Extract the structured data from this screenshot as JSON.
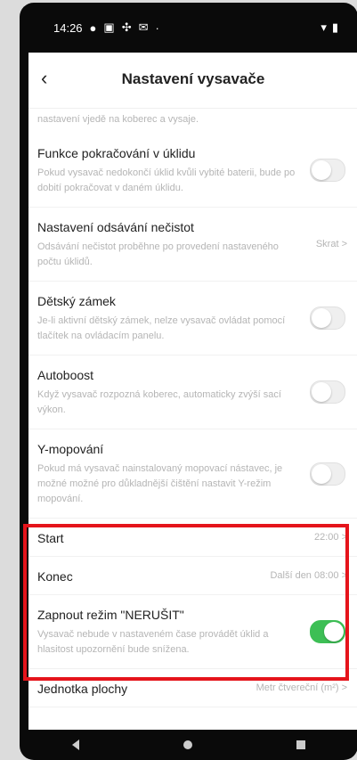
{
  "status_bar": {
    "time": "14:26",
    "icons_left": [
      "notification-dot",
      "notification-icon",
      "settings-icon",
      "mail-icon",
      "dot"
    ],
    "icons_right": [
      "wifi-icon",
      "battery-icon"
    ]
  },
  "header": {
    "title": "Nastavení vysavače"
  },
  "faded_top": "nastavení vjedě na koberec a vysaje.",
  "rows": [
    {
      "title": "Funkce pokračování v úklidu",
      "desc": "Pokud vysavač nedokončí úklid kvůli vybité baterii, bude po dobití pokračovat v daném úklidu.",
      "control": "toggle",
      "on": false
    },
    {
      "title": "Nastavení odsávání nečistot",
      "desc": "Odsávání nečistot proběhne po provedení nastaveného počtu úklidů.",
      "control": "value",
      "value": "Skrat >"
    },
    {
      "title": "Dětský zámek",
      "desc": "Je-li aktivní dětský zámek, nelze vysavač ovládat pomocí tlačítek na ovládacím panelu.",
      "control": "toggle",
      "on": false
    },
    {
      "title": "Autoboost",
      "desc": "Když vysavač rozpozná koberec, automaticky zvýší sací výkon.",
      "control": "toggle",
      "on": false
    },
    {
      "title": "Y-mopování",
      "desc": "Pokud má vysavač nainstalovaný mopovací nástavec, je možné možné pro důkladnější čištění nastavit Y-režim mopování.",
      "control": "toggle",
      "on": false
    },
    {
      "title": "Start",
      "desc": "",
      "control": "value",
      "value": "22:00 >"
    },
    {
      "title": "Konec",
      "desc": "",
      "control": "value",
      "value": "Další den 08:00 >"
    },
    {
      "title": "Zapnout režim \"NERUŠIT\"",
      "desc": "Vysavač nebude v nastaveném čase provádět úklid a hlasitost upozornění bude snížena.",
      "control": "toggle",
      "on": true
    },
    {
      "title": "Jednotka plochy",
      "desc": "",
      "control": "value",
      "value": "Metr čtvereční (m²) >"
    }
  ],
  "colors": {
    "toggle_on": "#3dbf55",
    "highlight": "#e5141b"
  }
}
